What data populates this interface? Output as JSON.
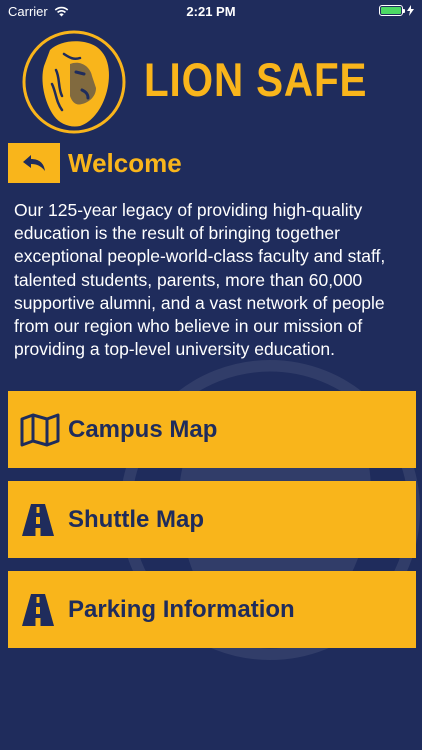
{
  "status_bar": {
    "carrier": "Carrier",
    "time": "2:21 PM",
    "battery_level": 1.0
  },
  "header": {
    "app_title": "LION SAFE",
    "logo_icon": "lion-head-icon"
  },
  "page": {
    "back_icon": "back-arrow-icon",
    "title": "Welcome",
    "description": "Our 125-year legacy of providing high-quality education is the result of bringing together exceptional people-world-class faculty and staff, talented students, parents, more than 60,000 supportive alumni, and a vast network of people from our region who believe in our mission of providing a top-level university education."
  },
  "buttons": [
    {
      "label": "Campus Map",
      "icon": "map-icon"
    },
    {
      "label": "Shuttle Map",
      "icon": "road-icon"
    },
    {
      "label": "Parking Information",
      "icon": "road-icon"
    }
  ],
  "colors": {
    "background": "#1f2c5c",
    "accent": "#f9b51b",
    "text_on_accent": "#1f2c5c"
  }
}
